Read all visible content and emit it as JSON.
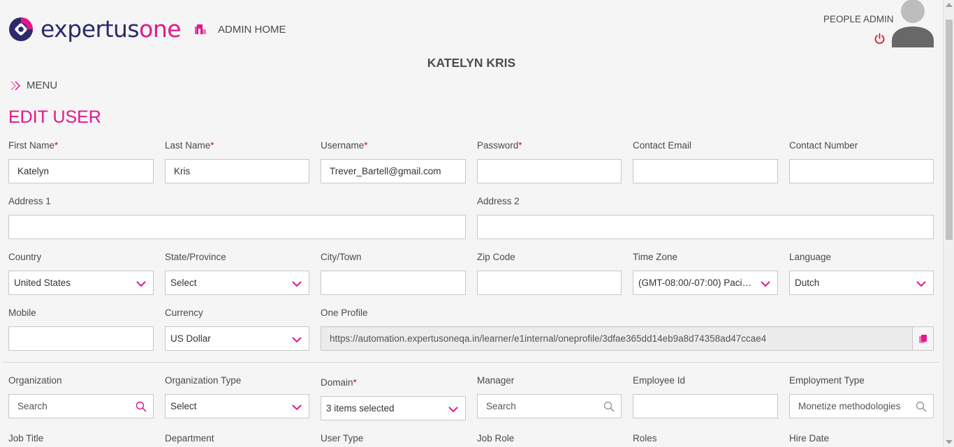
{
  "brand": {
    "logo_part1": "expertus",
    "logo_part2": "one",
    "accent": "#e4168c",
    "navy": "#2b2a6b"
  },
  "header": {
    "admin_home": "ADMIN HOME",
    "people_admin": "PEOPLE ADMIN",
    "user_name": "KATELYN KRIS",
    "menu_label": "MENU",
    "icons": [
      "logo-icon",
      "home-icon",
      "power-icon",
      "avatar-icon",
      "double-chevron-right-icon"
    ]
  },
  "page": {
    "title": "EDIT USER"
  },
  "form": {
    "first_name": {
      "label": "First Name",
      "value": "Katelyn",
      "required": "*"
    },
    "last_name": {
      "label": "Last Name",
      "value": "Kris",
      "required": "*"
    },
    "username": {
      "label": "Username",
      "value": "Trever_Bartell@gmail.com",
      "required": "*"
    },
    "password": {
      "label": "Password",
      "value": "",
      "required": "*"
    },
    "contact_email": {
      "label": "Contact Email",
      "value": ""
    },
    "contact_number": {
      "label": "Contact Number",
      "value": ""
    },
    "address1": {
      "label": "Address 1",
      "value": ""
    },
    "address2": {
      "label": "Address 2",
      "value": ""
    },
    "country": {
      "label": "Country",
      "value": "United States"
    },
    "state": {
      "label": "State/Province",
      "value": "Select"
    },
    "city": {
      "label": "City/Town",
      "value": ""
    },
    "zip": {
      "label": "Zip Code",
      "value": ""
    },
    "time_zone": {
      "label": "Time Zone",
      "value": "(GMT-08:00/-07:00) Pacific ..."
    },
    "language": {
      "label": "Language",
      "value": "Dutch"
    },
    "mobile": {
      "label": "Mobile",
      "value": ""
    },
    "currency": {
      "label": "Currency",
      "value": "US Dollar"
    },
    "one_profile": {
      "label": "One Profile",
      "value": "https://automation.expertusoneqa.in/learner/e1internal/oneprofile/3dfae365dd14eb9a8d74358ad47ccae4"
    },
    "organization": {
      "label": "Organization",
      "placeholder": "Search"
    },
    "organization_type": {
      "label": "Organization Type",
      "value": "Select"
    },
    "domain": {
      "label": "Domain",
      "value": "3 items selected",
      "required": "*"
    },
    "manager": {
      "label": "Manager",
      "placeholder": "Search"
    },
    "employee_id": {
      "label": "Employee Id",
      "value": ""
    },
    "employment_type": {
      "label": "Employment Type",
      "value": "Monetize methodologies"
    },
    "job_title": {
      "label": "Job Title"
    },
    "department": {
      "label": "Department"
    },
    "user_type": {
      "label": "User Type"
    },
    "job_role": {
      "label": "Job Role"
    },
    "roles": {
      "label": "Roles"
    },
    "hire_date": {
      "label": "Hire Date"
    }
  }
}
